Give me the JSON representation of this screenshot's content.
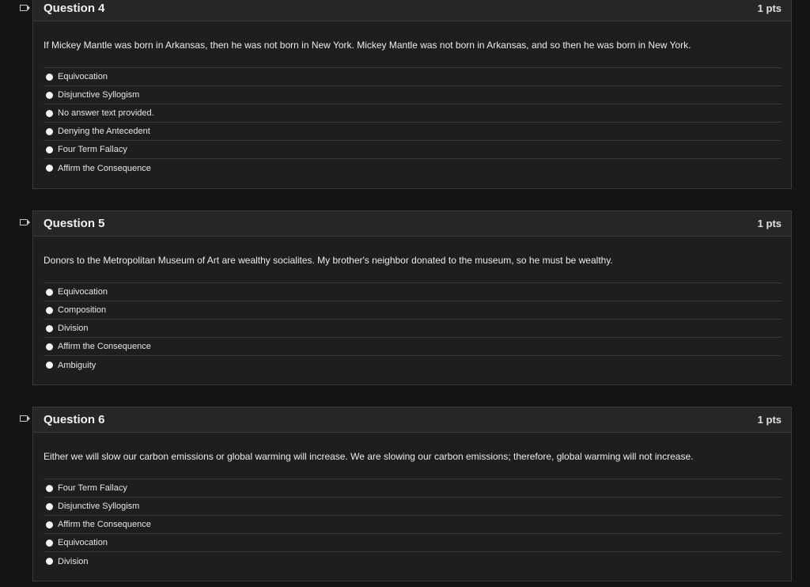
{
  "questions": [
    {
      "title": "Question 4",
      "points": "1 pts",
      "text": "If Mickey Mantle was born in Arkansas, then he was not born in New York. Mickey Mantle was not born in Arkansas, and so then he was born in New York.",
      "answers": [
        "Equivocation",
        "Disjunctive Syllogism",
        "No answer text provided.",
        "Denying the Antecedent",
        "Four Term Fallacy",
        "Affirm the Consequence"
      ]
    },
    {
      "title": "Question 5",
      "points": "1 pts",
      "text": "Donors to the Metropolitan Museum of Art are wealthy socialites. My brother's neighbor donated to the museum, so he must be wealthy.",
      "answers": [
        "Equivocation",
        "Composition",
        "Division",
        "Affirm the Consequence",
        "Ambiguity"
      ]
    },
    {
      "title": "Question 6",
      "points": "1 pts",
      "text": "Either we will slow our carbon emissions or global warming will increase. We are slowing our carbon emissions; therefore, global warming will not increase.",
      "answers": [
        "Four Term Fallacy",
        "Disjunctive Syllogism",
        "Affirm the Consequence",
        "Equivocation",
        "Division"
      ]
    }
  ],
  "icons": {
    "flag": "flag-icon",
    "radio": "radio-icon"
  },
  "colors": {
    "background": "#141414",
    "card": "#1e1e1e",
    "header": "#262626",
    "border": "#3a3a3a",
    "text": "#e8e8e8"
  }
}
